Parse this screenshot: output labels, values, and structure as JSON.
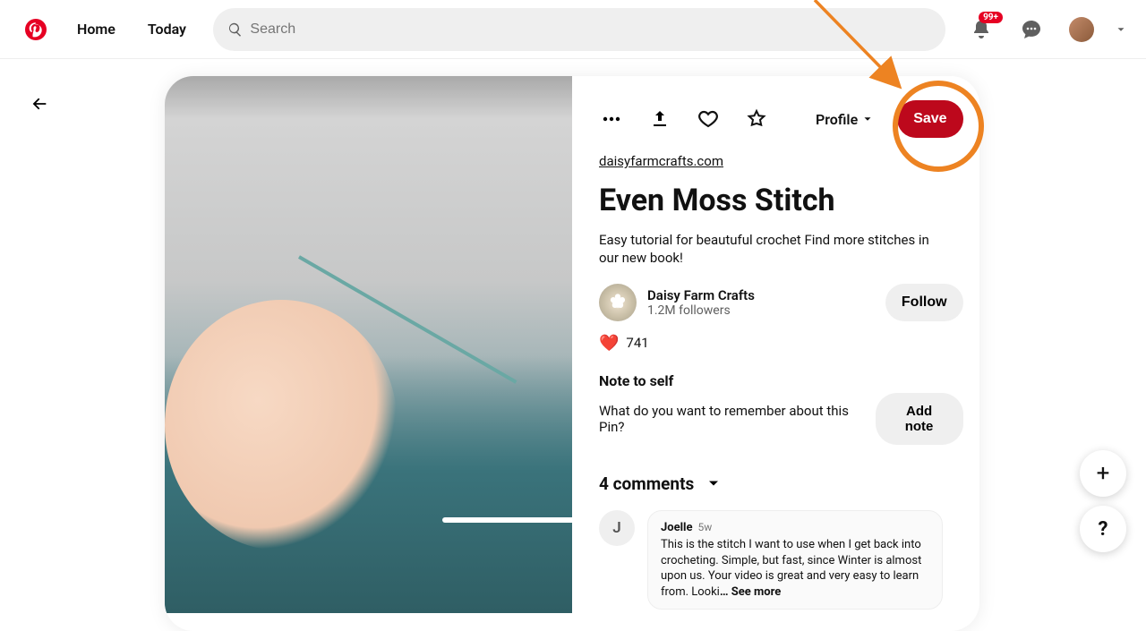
{
  "header": {
    "home": "Home",
    "today": "Today",
    "search_placeholder": "Search",
    "notif_badge": "99+"
  },
  "pin": {
    "source_url": "daisyfarmcrafts.com",
    "title": "Even Moss Stitch",
    "description": "Easy tutorial for beautuful crochet Find more stitches in our new book!",
    "board_selector": "Profile",
    "save": "Save",
    "author": {
      "name": "Daisy Farm Crafts",
      "followers": "1.2M followers"
    },
    "follow": "Follow",
    "reactions": "741",
    "note": {
      "heading": "Note to self",
      "prompt": "What do you want to remember about this Pin?",
      "add": "Add note"
    },
    "comments": {
      "count_label": "4 comments"
    },
    "comment1": {
      "initial": "J",
      "name": "Joelle",
      "time": "5w",
      "text": "This is the stitch I want to use when I get back into crocheting. Simple, but fast, since Winter is almost upon us. Your video is great and very easy to learn from. Looki",
      "more": "… See more"
    }
  },
  "fab": {
    "plus": "+",
    "help": "?"
  }
}
